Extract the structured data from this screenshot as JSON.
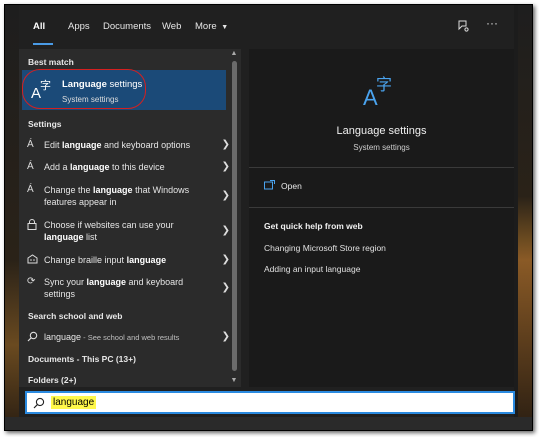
{
  "tabs": {
    "all": "All",
    "apps": "Apps",
    "documents": "Documents",
    "web": "Web",
    "more": "More"
  },
  "sections": {
    "best_match": "Best match",
    "settings": "Settings",
    "search_web": "Search school and web",
    "documents": "Documents - This PC (13+)",
    "folders": "Folders (2+)"
  },
  "best_match": {
    "title": "settings",
    "title_bold": "Language",
    "subtitle": "System settings"
  },
  "settings_items": [
    {
      "pre": "Edit ",
      "bold": "language",
      "post": " and keyboard options"
    },
    {
      "pre": "Add a ",
      "bold": "language",
      "post": " to this device"
    },
    {
      "pre": "Change the ",
      "bold": "language",
      "post": " that Windows features appear in"
    },
    {
      "pre": "Choose if websites can use your ",
      "bold": "language",
      "post": " list"
    },
    {
      "pre": "Change braille input ",
      "bold": "language",
      "post": ""
    },
    {
      "pre": "Sync your ",
      "bold": "language",
      "post": " and keyboard settings"
    }
  ],
  "web_item": {
    "query": "language",
    "hint": " - See school and web results"
  },
  "detail": {
    "title": "Language settings",
    "subtitle": "System settings",
    "open": "Open",
    "help_heading": "Get quick help from web",
    "links": [
      "Changing Microsoft Store region",
      "Adding an input language"
    ]
  },
  "search": {
    "value": "language"
  },
  "colors": {
    "accent": "#4a9be6",
    "selected": "#1b4a78",
    "highlight": "#fff84a",
    "annotation": "#d42020"
  }
}
